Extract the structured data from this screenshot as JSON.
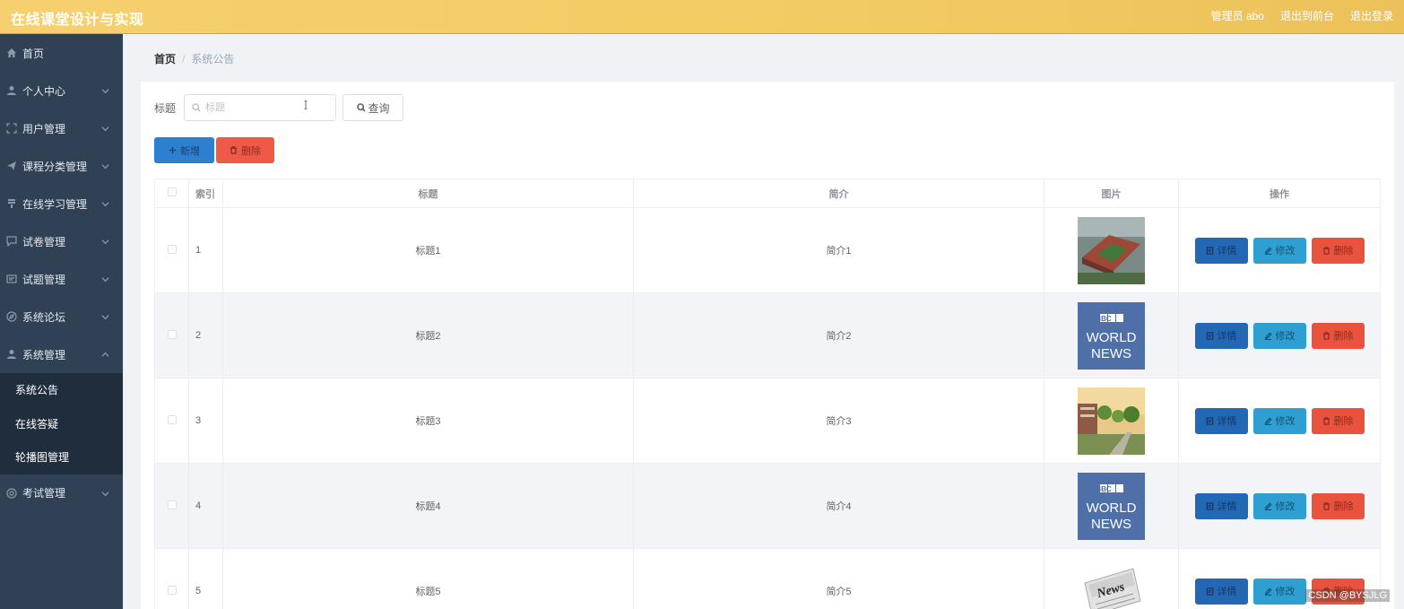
{
  "app": {
    "title": "在线课堂设计与实现",
    "admin_label": "管理员 abo",
    "back_to_front": "退出到前台",
    "logout": "退出登录"
  },
  "sidebar": {
    "items": [
      {
        "label": "首页",
        "icon": "home-icon",
        "expandable": false
      },
      {
        "label": "个人中心",
        "icon": "user-icon",
        "expandable": true
      },
      {
        "label": "用户管理",
        "icon": "fullscreen-icon",
        "expandable": true
      },
      {
        "label": "课程分类管理",
        "icon": "send-icon",
        "expandable": true
      },
      {
        "label": "在线学习管理",
        "icon": "trophy-icon",
        "expandable": true
      },
      {
        "label": "试卷管理",
        "icon": "chat-icon",
        "expandable": true
      },
      {
        "label": "试题管理",
        "icon": "message-icon",
        "expandable": true
      },
      {
        "label": "系统论坛",
        "icon": "compass-icon",
        "expandable": true
      },
      {
        "label": "系统管理",
        "icon": "user-icon",
        "expandable": true,
        "open": true
      },
      {
        "label": "考试管理",
        "icon": "settings-icon",
        "expandable": true
      }
    ],
    "submenu": [
      "系统公告",
      "在线答疑",
      "轮播图管理"
    ],
    "active_sub": "系统公告"
  },
  "breadcrumb": {
    "home": "首页",
    "separator": "/",
    "current": "系统公告"
  },
  "search": {
    "label": "标题",
    "placeholder": "标题",
    "value": "",
    "button": "查询"
  },
  "actions": {
    "add": "新增",
    "delete": "删除"
  },
  "table": {
    "headers": {
      "index": "索引",
      "title": "标题",
      "intro": "简介",
      "image": "图片",
      "ops": "操作"
    },
    "rows": [
      {
        "index": "1",
        "title": "标题1",
        "intro": "简介1",
        "image": "campus-aerial-photo"
      },
      {
        "index": "2",
        "title": "标题2",
        "intro": "简介2",
        "image": "bbc-world-news-logo"
      },
      {
        "index": "3",
        "title": "标题3",
        "intro": "简介3",
        "image": "campus-street-photo"
      },
      {
        "index": "4",
        "title": "标题4",
        "intro": "简介4",
        "image": "bbc-world-news-logo"
      },
      {
        "index": "5",
        "title": "标题5",
        "intro": "简介5",
        "image": "news-newspaper-photo"
      }
    ],
    "row_actions": {
      "detail": "详情",
      "edit": "修改",
      "delete": "删除"
    }
  },
  "bbc_logo": {
    "line1": "BBC",
    "line2": "WORLD",
    "line3": "NEWS"
  },
  "news_word": "News",
  "watermark": "CSDN @BYSJLG",
  "colors": {
    "header": "#f6d06f",
    "sidebar": "#304156",
    "primary": "#2d7fd0",
    "danger": "#ee5a47",
    "info": "#2e9fd0"
  }
}
